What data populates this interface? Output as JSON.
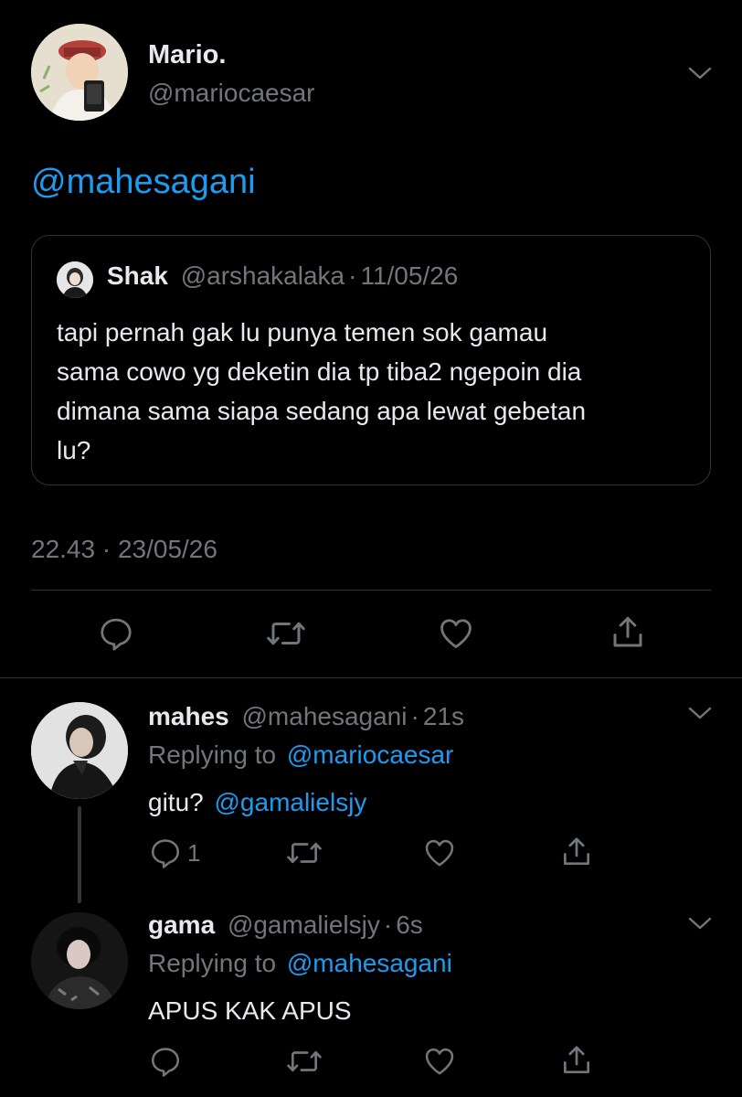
{
  "main_tweet": {
    "display_name": "Mario.",
    "handle": "@mariocaesar",
    "mention": "@mahesagani",
    "timestamp": "22.43 · 23/05/26",
    "quoted": {
      "display_name": "Shak",
      "handle": "@arshakalaka",
      "dot": "·",
      "date": "11/05/26",
      "text_lines": [
        "tapi pernah gak lu punya temen sok gamau",
        "sama cowo yg deketin dia tp tiba2 ngepoin dia",
        "dimana sama siapa sedang apa lewat gebetan",
        "lu?"
      ]
    }
  },
  "replies": [
    {
      "display_name": "mahes",
      "handle": "@mahesagani",
      "dot": "·",
      "time": "21s",
      "replying_prefix": "Replying to",
      "replying_to": "@mariocaesar",
      "text": "gitu?",
      "text_mention": "@gamalielsjy",
      "reply_count": "1"
    },
    {
      "display_name": "gama",
      "handle": "@gamalielsjy",
      "dot": "·",
      "time": "6s",
      "replying_prefix": "Replying to",
      "replying_to": "@mahesagani",
      "text": "APUS KAK APUS",
      "reply_count": ""
    }
  ],
  "icons": {
    "reply": "reply-icon",
    "retweet": "retweet-icon",
    "like": "heart-icon",
    "share": "share-icon",
    "more": "chevron-down-icon"
  },
  "colors": {
    "background": "#000000",
    "text": "#e7e9ea",
    "muted": "#71767b",
    "link": "#1d9bf0",
    "separator": "#2f3336"
  }
}
